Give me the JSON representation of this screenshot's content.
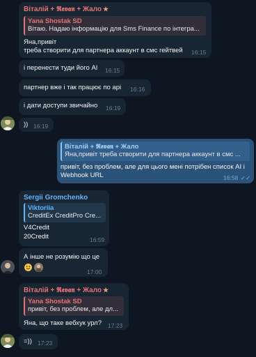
{
  "msg1": {
    "sender": "Віталій + 𝕽𝖊𝖛𝖆𝖓 + Жало",
    "star": "★",
    "reply_name": "Yana Shostak SD",
    "reply_text": "Вітаю.  Надаю інформацію для Sms Finance по інтегра...",
    "line1": "Яна,привіт",
    "line2": "треба створити для партнера аккаунт в смс гейтвей",
    "time": "16:15"
  },
  "msg2": {
    "text": "і перенести туди його AI",
    "time": "16:15"
  },
  "msg3": {
    "text": "партнер вже і так працює по api",
    "time": "16:16"
  },
  "msg4": {
    "text": "і дати доступи звичайно",
    "time": "16:19"
  },
  "msg5": {
    "text": "))",
    "time": "16:19"
  },
  "msg6": {
    "reply_name": "Віталій + 𝕽𝖊𝖛𝖆𝖓 + Жало",
    "reply_text": "Яна,привіт  треба створити для партнера аккаунт в смс ...",
    "line1": "привіт, без проблем, але для цього мені потрібен список AI і",
    "line2": "Webhook URL",
    "time": "16:58",
    "check": "✓✓"
  },
  "msg7": {
    "sender": "Sergii Gromchenko",
    "reply_name": "Viktoriia",
    "reply_text": "CreditEx CreditPro Cre...",
    "line1": "V4Credit",
    "line2": "20Credit",
    "time": "16:59"
  },
  "msg8": {
    "line1": "А інше не розумію що це",
    "time": "17:00"
  },
  "msg9": {
    "sender": "Віталій + 𝕽𝖊𝖛𝖆𝖓 + Жало",
    "star": "★",
    "reply_name": "Yana Shostak SD",
    "reply_text": "привіт, без проблем, але дл...",
    "text": "Яна, що таке вебхук урл?",
    "time": "17:23"
  },
  "msg10": {
    "text": "=))",
    "time": "17:23"
  },
  "colors": {
    "background": "#0e1621",
    "incoming": "#182533",
    "outgoing": "#2b5278",
    "sender_red": "#e57373",
    "sender_blue": "#64b5f6",
    "reply_pink": "#e57373",
    "reply_blue": "#64b5f6",
    "reply_teal": "#64b5f6"
  }
}
